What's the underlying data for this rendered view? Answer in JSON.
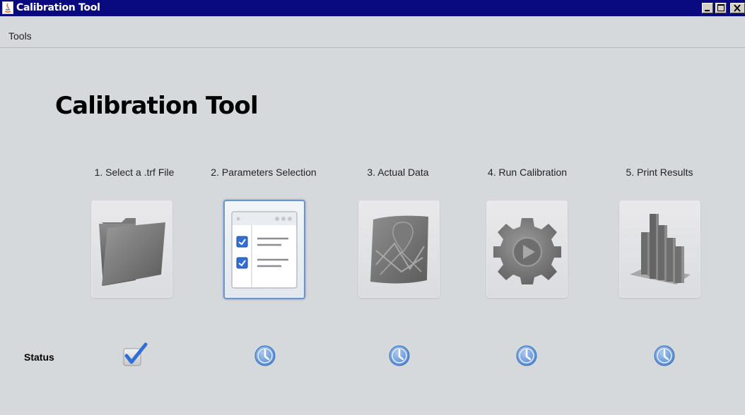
{
  "window": {
    "title": "Calibration Tool",
    "controls": [
      "minimize",
      "maximize",
      "close"
    ]
  },
  "menubar": {
    "items": [
      {
        "label": "Tools"
      }
    ]
  },
  "main": {
    "heading": "Calibration Tool",
    "steps": [
      {
        "label": "1. Select a .trf File",
        "icon": "folder-icon",
        "status": "done"
      },
      {
        "label": "2. Parameters Selection",
        "icon": "checklist-icon",
        "status": "pending",
        "active": true
      },
      {
        "label": "3. Actual Data",
        "icon": "map-icon",
        "status": "pending"
      },
      {
        "label": "4. Run Calibration",
        "icon": "gear-play-icon",
        "status": "pending"
      },
      {
        "label": "5. Print Results",
        "icon": "bar-chart-icon",
        "status": "pending"
      }
    ],
    "status_label": "Status"
  },
  "colors": {
    "titlebar": "#0a0a80",
    "background": "#d6d9dc",
    "active_border": "#6d94c6",
    "clock_blue": "#6a9ee0",
    "check_blue": "#2f6fd6"
  }
}
